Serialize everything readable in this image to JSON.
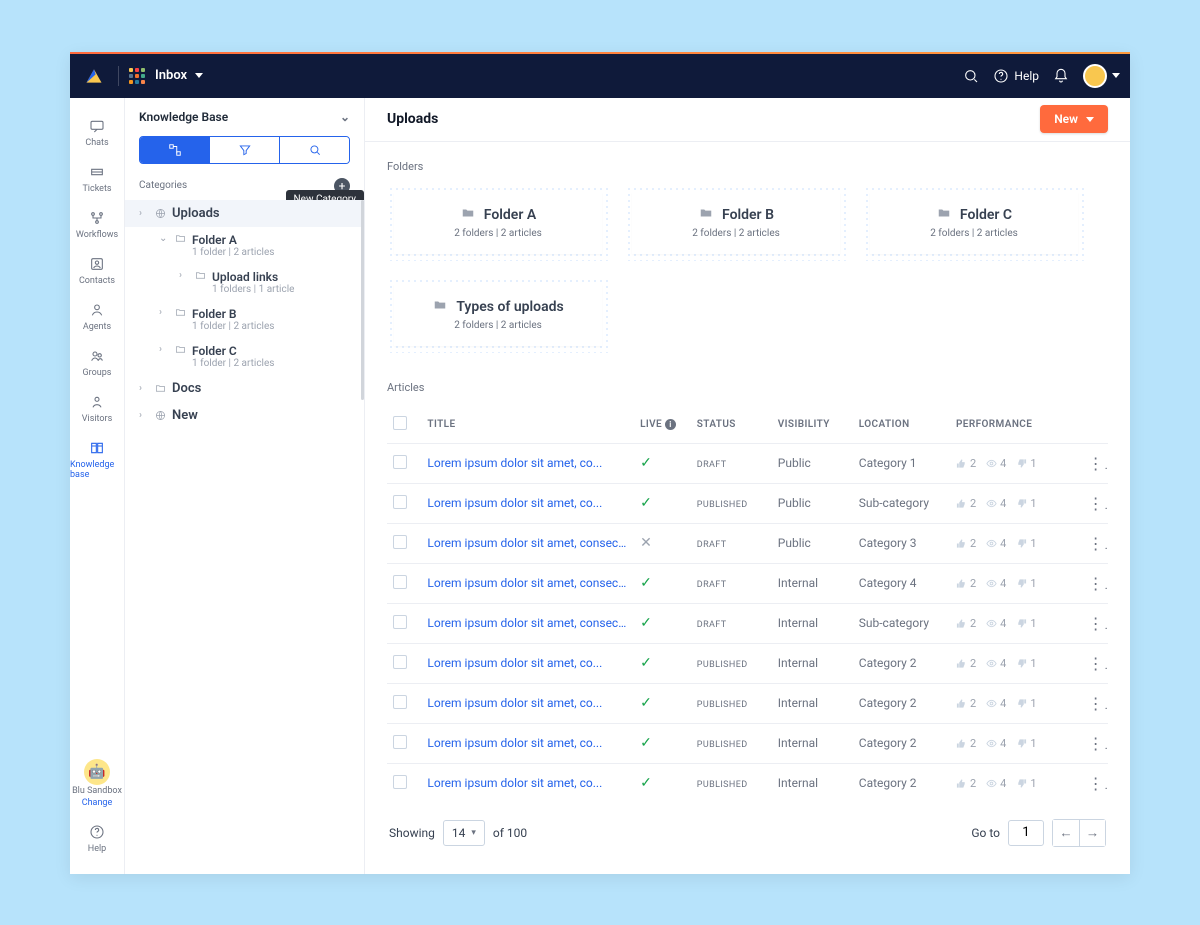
{
  "topbar": {
    "section": "Inbox",
    "help_label": "Help"
  },
  "rail": {
    "items": [
      {
        "label": "Chats"
      },
      {
        "label": "Tickets"
      },
      {
        "label": "Workflows"
      },
      {
        "label": "Contacts"
      },
      {
        "label": "Agents"
      },
      {
        "label": "Groups"
      },
      {
        "label": "Visitors"
      },
      {
        "label": "Knowledge base"
      }
    ],
    "bot_name": "Blu Sandbox",
    "change_label": "Change",
    "help_label": "Help"
  },
  "tree": {
    "header": "Knowledge Base",
    "categories_label": "Categories",
    "tooltip": "New Category",
    "nodes": [
      {
        "label": "Uploads",
        "level": 1,
        "selected": true,
        "icon": "globe"
      },
      {
        "label": "Folder A",
        "meta": "1 folder | 2 articles",
        "level": 2,
        "expanded": true
      },
      {
        "label": "Upload links",
        "meta": "1 folders | 1 article",
        "level": 3
      },
      {
        "label": "Folder B",
        "meta": "1 folder | 2 articles",
        "level": 2
      },
      {
        "label": "Folder C",
        "meta": "1 folder | 2 articles",
        "level": 2
      },
      {
        "label": "Docs",
        "level": 1,
        "icon": "folder"
      },
      {
        "label": "New",
        "level": 1,
        "icon": "globe"
      }
    ]
  },
  "main": {
    "title": "Uploads",
    "new_label": "New",
    "folders_label": "Folders",
    "folders": [
      {
        "title": "Folder A",
        "meta": "2 folders | 2 articles"
      },
      {
        "title": "Folder B",
        "meta": "2 folders | 2 articles"
      },
      {
        "title": "Folder C",
        "meta": "2 folders | 2 articles"
      },
      {
        "title": "Types of uploads",
        "meta": "2 folders | 2 articles"
      }
    ],
    "articles_label": "Articles",
    "columns": [
      "TITLE",
      "LIVE",
      "STATUS",
      "VISIBILITY",
      "LOCATION",
      "PERFORMANCE"
    ],
    "rows": [
      {
        "title": "Lorem ipsum dolor sit amet, co...",
        "live": true,
        "status": "DRAFT",
        "visibility": "Public",
        "location": "Category 1",
        "likes": 2,
        "views": 4,
        "dislikes": 1
      },
      {
        "title": "Lorem ipsum dolor sit amet, co...",
        "live": true,
        "status": "PUBLISHED",
        "visibility": "Public",
        "location": "Sub-category",
        "likes": 2,
        "views": 4,
        "dislikes": 1
      },
      {
        "title": "Lorem ipsum dolor sit amet, consectetur...",
        "live": false,
        "status": "DRAFT",
        "visibility": "Public",
        "location": "Category 3",
        "likes": 2,
        "views": 4,
        "dislikes": 1
      },
      {
        "title": "Lorem ipsum dolor sit amet, consectetur...",
        "live": true,
        "status": "DRAFT",
        "visibility": "Internal",
        "location": "Category 4",
        "likes": 2,
        "views": 4,
        "dislikes": 1
      },
      {
        "title": "Lorem ipsum dolor sit amet, consectetur...",
        "live": true,
        "status": "DRAFT",
        "visibility": "Internal",
        "location": "Sub-category",
        "likes": 2,
        "views": 4,
        "dislikes": 1
      },
      {
        "title": "Lorem ipsum dolor sit amet, co...",
        "live": true,
        "status": "PUBLISHED",
        "visibility": "Internal",
        "location": "Category 2",
        "likes": 2,
        "views": 4,
        "dislikes": 1
      },
      {
        "title": "Lorem ipsum dolor sit amet, co...",
        "live": true,
        "status": "PUBLISHED",
        "visibility": "Internal",
        "location": "Category 2",
        "likes": 2,
        "views": 4,
        "dislikes": 1
      },
      {
        "title": "Lorem ipsum dolor sit amet, co...",
        "live": true,
        "status": "PUBLISHED",
        "visibility": "Internal",
        "location": "Category 2",
        "likes": 2,
        "views": 4,
        "dislikes": 1
      },
      {
        "title": "Lorem ipsum dolor sit amet, co...",
        "live": true,
        "status": "PUBLISHED",
        "visibility": "Internal",
        "location": "Category 2",
        "likes": 2,
        "views": 4,
        "dislikes": 1
      }
    ],
    "pager": {
      "showing_label": "Showing",
      "page_size": "14",
      "of_label": "of 100",
      "goto_label": "Go to",
      "page": "1"
    }
  }
}
